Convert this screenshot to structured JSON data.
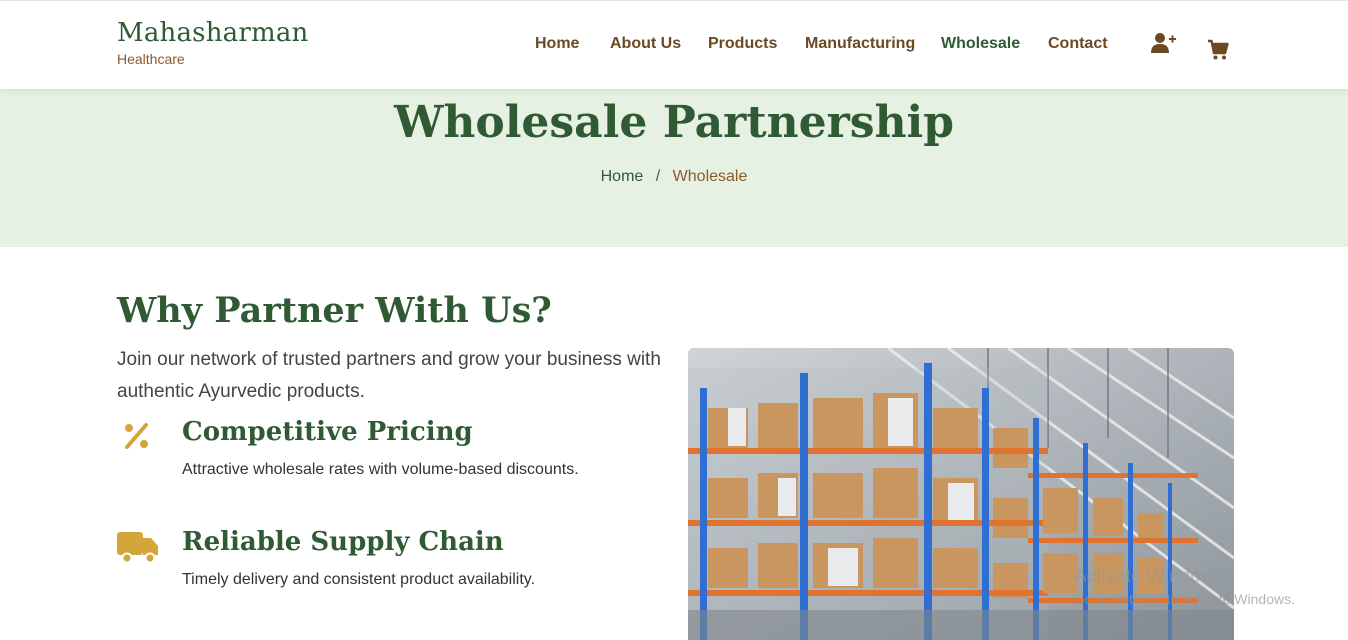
{
  "header": {
    "brand_name": "Mahasharman",
    "brand_sub": "Healthcare",
    "nav": [
      {
        "label": "Home"
      },
      {
        "label": "About Us"
      },
      {
        "label": "Products"
      },
      {
        "label": "Manufacturing"
      },
      {
        "label": "Wholesale",
        "active": true
      },
      {
        "label": "Contact"
      }
    ],
    "icons": [
      "user-plus-icon",
      "cart-icon"
    ]
  },
  "hero": {
    "title": "Wholesale Partnership",
    "breadcrumb": {
      "home": "Home",
      "separator": "/",
      "current": "Wholesale"
    }
  },
  "why": {
    "title": "Why Partner With Us?",
    "lead": "Join our network of trusted partners and grow your business with authentic Ayurvedic products.",
    "features": [
      {
        "icon": "percent-icon",
        "title": "Competitive Pricing",
        "desc": "Attractive wholesale rates with volume-based discounts."
      },
      {
        "icon": "truck-icon",
        "title": "Reliable Supply Chain",
        "desc": "Timely delivery and consistent product availability."
      }
    ]
  },
  "photo": {
    "subject": "warehouse-shelves-image"
  },
  "watermark": {
    "title": "Activate Windows",
    "sub": "Go to Settings to activate Windows."
  },
  "colors": {
    "brand_green": "#2f5a34",
    "brown": "#6b4a22",
    "accent_gold": "#d4a63a",
    "hero_bg": "#e6f1e3"
  }
}
